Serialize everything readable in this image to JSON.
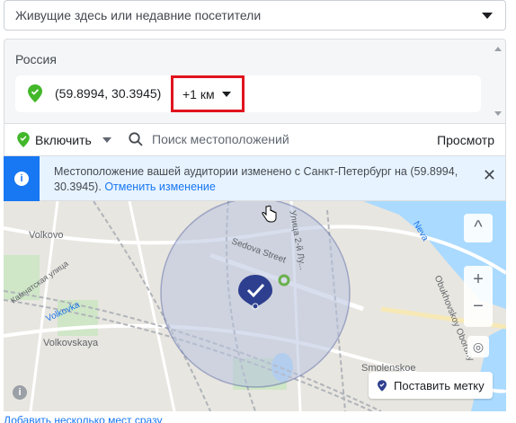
{
  "audience_select": {
    "value": "Живущие здесь или недавние посетители"
  },
  "location_panel": {
    "country": "Россия",
    "pin": {
      "coords": "(59.8994, 30.3945)",
      "radius": "+1 км"
    }
  },
  "toolbar": {
    "include_label": "Включить",
    "search_placeholder": "Поиск местоположений",
    "browse_label": "Просмотр"
  },
  "notice": {
    "text": "Местоположение вашей аудитории изменено с Санкт-Петербург на (59.8994, 30.3945).",
    "undo_label": "Отменить изменение"
  },
  "map": {
    "labels": {
      "volkovo": "Volkovo",
      "volkovskaya": "Volkovskaya",
      "kamchatskaya": "Камчатская улица",
      "volkovka": "Volkovka",
      "sedova": "Sedova Street",
      "neva": "Neva",
      "obukhovskoy": "Obukhovskoy Oborony",
      "smolenskoe": "Smolenskoe",
      "lun": "Улица 2-й Лу..."
    },
    "controls": {
      "zoom_in": "+",
      "zoom_out": "−",
      "collapse": "^"
    },
    "place_pin_label": "Поставить метку",
    "colors": {
      "water": "#aadaff",
      "radius_fill": "#b8c3de",
      "pin": "#2e3f8f"
    }
  },
  "footer": {
    "add_multiple_link": "Добавить несколько мест сразу"
  },
  "colors": {
    "accent": "#1877f2",
    "highlight": "#e0141e",
    "include_green": "#42b72a"
  }
}
